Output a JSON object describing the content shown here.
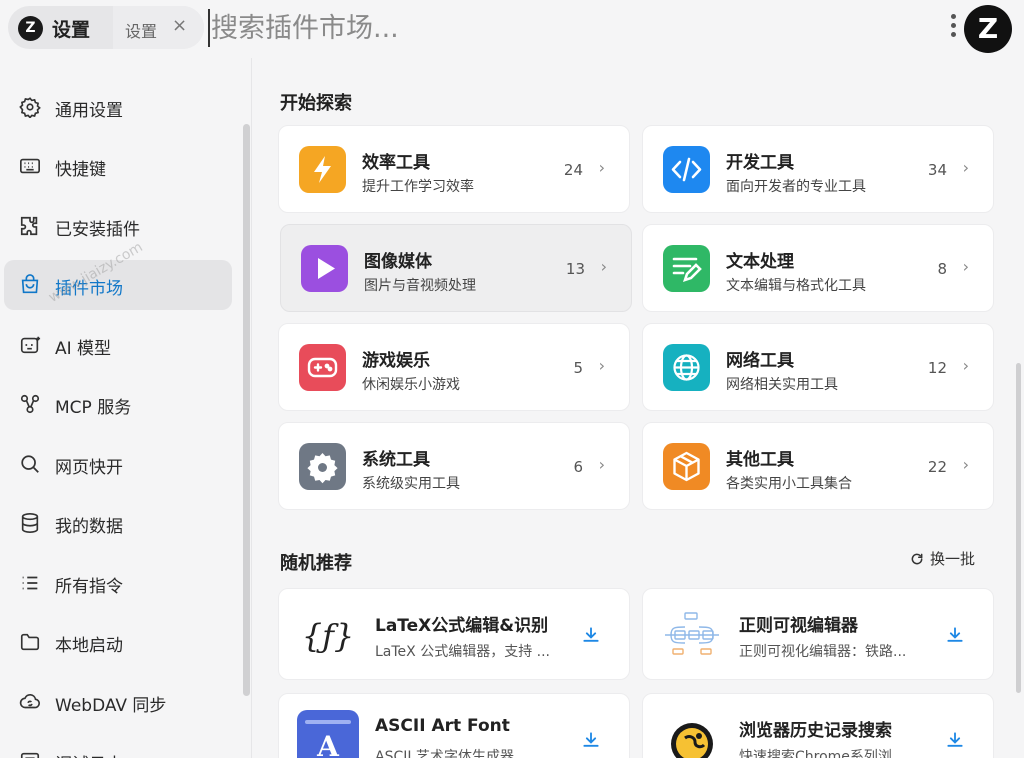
{
  "header": {
    "logo_letter": "Z",
    "title": "设置",
    "subtitle": "设置",
    "close_glyph": "×",
    "search_placeholder": "搜索插件市场...",
    "app_logo_letter": "Z"
  },
  "sidebar": {
    "items": [
      {
        "label": "通用设置",
        "icon": "gear-icon"
      },
      {
        "label": "快捷键",
        "icon": "keyboard-icon"
      },
      {
        "label": "已安装插件",
        "icon": "puzzle-icon"
      },
      {
        "label": "插件市场",
        "icon": "shopping-bag-icon",
        "active": true
      },
      {
        "label": "AI 模型",
        "icon": "ai-robot-icon"
      },
      {
        "label": "MCP 服务",
        "icon": "mcp-icon"
      },
      {
        "label": "网页快开",
        "icon": "search-icon"
      },
      {
        "label": "我的数据",
        "icon": "database-icon"
      },
      {
        "label": "所有指令",
        "icon": "list-icon"
      },
      {
        "label": "本地启动",
        "icon": "folder-icon"
      },
      {
        "label": "WebDAV 同步",
        "icon": "cloud-sync-icon"
      },
      {
        "label": "调试日志",
        "icon": "log-icon"
      }
    ]
  },
  "main": {
    "explore_title": "开始探索",
    "categories": [
      {
        "name": "效率工具",
        "desc": "提升工作学习效率",
        "count": "24",
        "icon": "lightning-icon",
        "color": "#f5a623"
      },
      {
        "name": "开发工具",
        "desc": "面向开发者的专业工具",
        "count": "34",
        "icon": "code-icon",
        "color": "#1e88f0"
      },
      {
        "name": "图像媒体",
        "desc": "图片与音视频处理",
        "count": "13",
        "icon": "play-icon",
        "color": "#9b4fe0"
      },
      {
        "name": "文本处理",
        "desc": "文本编辑与格式化工具",
        "count": "8",
        "icon": "edit-text-icon",
        "color": "#2fb866"
      },
      {
        "name": "游戏娱乐",
        "desc": "休闲娱乐小游戏",
        "count": "5",
        "icon": "gamepad-icon",
        "color": "#e84c5a"
      },
      {
        "name": "网络工具",
        "desc": "网络相关实用工具",
        "count": "12",
        "icon": "globe-icon",
        "color": "#16b1c0"
      },
      {
        "name": "系统工具",
        "desc": "系统级实用工具",
        "count": "6",
        "icon": "cog-icon",
        "color": "#6f7885"
      },
      {
        "name": "其他工具",
        "desc": "各类实用小工具集合",
        "count": "22",
        "icon": "box-icon",
        "color": "#f08a24"
      }
    ],
    "chevron": "›",
    "recommend_title": "随机推荐",
    "refresh_label": "换一批",
    "recommendations": [
      {
        "name": "LaTeX公式编辑&识别",
        "desc": "LaTeX 公式编辑器，支持 ...",
        "icon": "formula-icon"
      },
      {
        "name": "正则可视编辑器",
        "desc": "正则可视化编辑器：铁路...",
        "icon": "regex-diagram-icon"
      },
      {
        "name": "ASCII Art Font",
        "desc": "ASCII 艺术字体生成器",
        "icon": "ascii-font-icon"
      },
      {
        "name": "浏览器历史记录搜索",
        "desc": "快速搜索Chrome系列浏",
        "icon": "planet-icon"
      }
    ]
  },
  "watermark": "www.jiaizy.com",
  "colors": {
    "accent": "#1177c8",
    "active_bg": "#e4e4e6"
  }
}
